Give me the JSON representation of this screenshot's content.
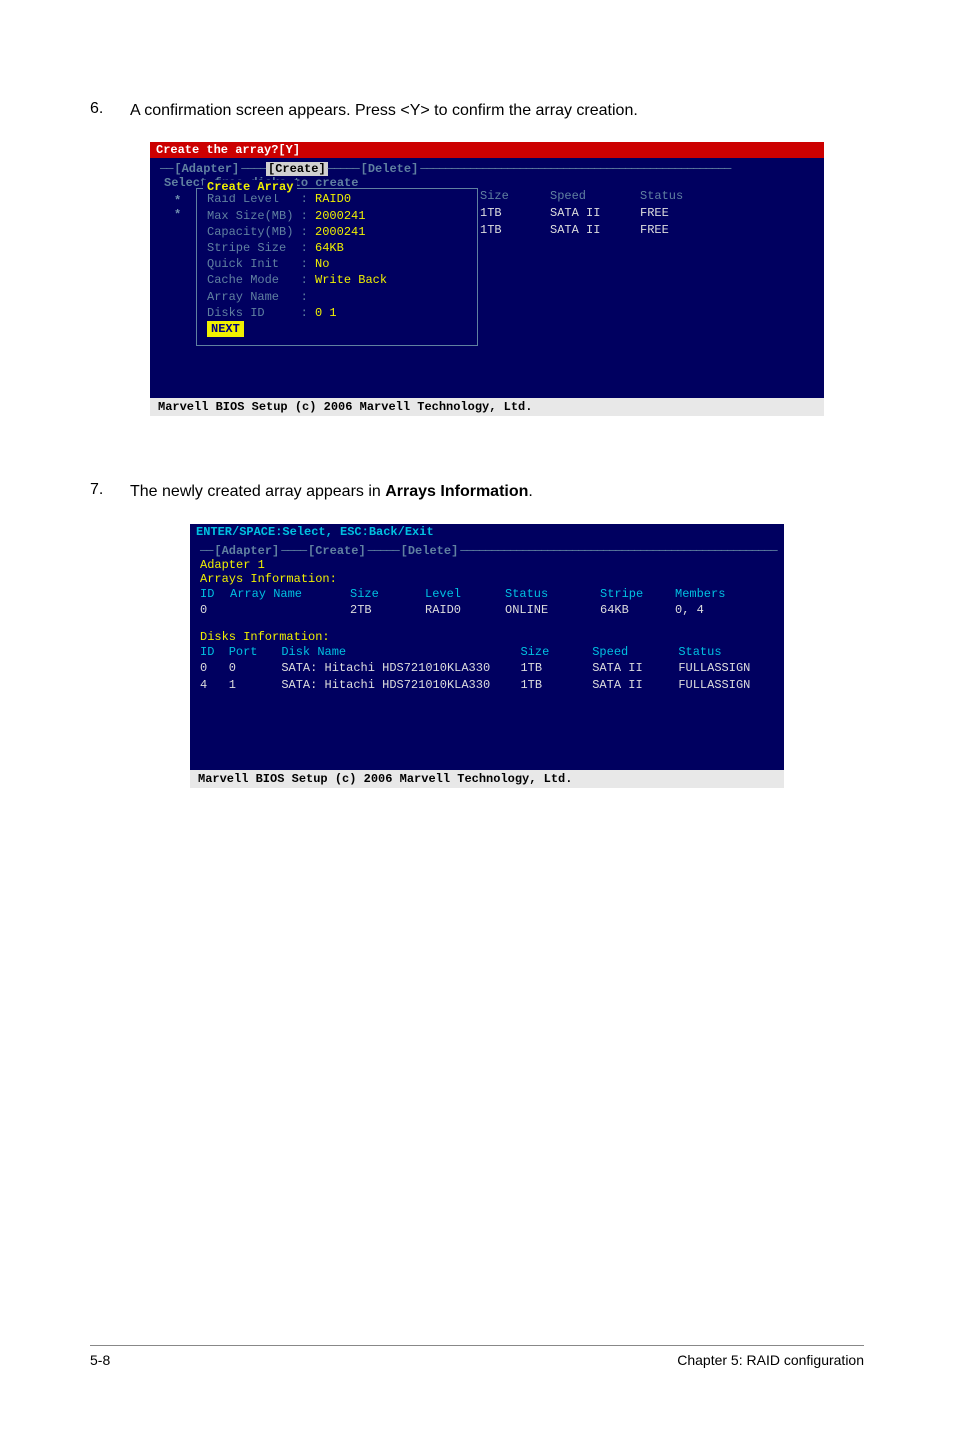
{
  "step6": {
    "num": "6.",
    "text": "A confirmation screen appears. Press <Y> to confirm the array creation."
  },
  "step7": {
    "num": "7.",
    "text_pre": "The newly created array appears in ",
    "text_bold": "Arrays Information",
    "text_post": "."
  },
  "bios1": {
    "header": "Create the array?[Y]",
    "tabs": {
      "adapter": "[Adapter]",
      "create": "[Create]",
      "delete": "[Delete]"
    },
    "sel_disks": "Select free disks to create",
    "create_array_title": "Create Array",
    "fields": {
      "raid_level": {
        "label": "Raid Level   ",
        "colon": ": ",
        "value": "RAID0"
      },
      "max_size": {
        "label": "Max Size(MB) ",
        "colon": ": ",
        "value": "2000241"
      },
      "capacity": {
        "label": "Capacity(MB) ",
        "colon": ": ",
        "value": "2000241"
      },
      "stripe_size": {
        "label": "Stripe Size  ",
        "colon": ": ",
        "value": "64KB"
      },
      "quick_init": {
        "label": "Quick Init   ",
        "colon": ": ",
        "value": "No"
      },
      "cache_mode": {
        "label": "Cache Mode   ",
        "colon": ": ",
        "value": "Write Back"
      },
      "array_name": {
        "label": "Array Name   ",
        "colon": ": ",
        "value": ""
      },
      "disks_id": {
        "label": "Disks ID     ",
        "colon": ": ",
        "value": "0 1"
      }
    },
    "next": "NEXT",
    "disk_headers": {
      "size": "Size",
      "speed": "Speed",
      "status": "Status"
    },
    "disks": [
      {
        "size": "1TB",
        "speed": "SATA II",
        "status": "FREE"
      },
      {
        "size": "1TB",
        "speed": "SATA II",
        "status": "FREE"
      }
    ],
    "footer": "Marvell BIOS Setup (c) 2006 Marvell Technology, Ltd."
  },
  "bios2": {
    "hint": "ENTER/SPACE:Select, ESC:Back/Exit",
    "tabs": {
      "adapter": "[Adapter]",
      "create": "[Create]",
      "delete": "[Delete]"
    },
    "adapter": "Adapter 1",
    "arrays_title": "Arrays Information:",
    "arrays_headers": {
      "id": "ID",
      "name": "Array Name",
      "size": "Size",
      "level": "Level",
      "status": "Status",
      "stripe": "Stripe",
      "members": "Members"
    },
    "arrays": [
      {
        "id": "0",
        "name": "",
        "size": "2TB",
        "level": "RAID0",
        "status": "ONLINE",
        "stripe": "64KB",
        "members": "0, 4"
      }
    ],
    "disks_title": "Disks Information:",
    "disks_headers": {
      "id": "ID",
      "port": "Port",
      "name": "Disk Name",
      "size": "Size",
      "speed": "Speed",
      "status": "Status"
    },
    "disks": [
      {
        "id": "0",
        "port": "0",
        "name": "SATA: Hitachi HDS721010KLA330",
        "size": "1TB",
        "speed": "SATA II",
        "status": "FULLASSIGN"
      },
      {
        "id": "4",
        "port": "1",
        "name": "SATA: Hitachi HDS721010KLA330",
        "size": "1TB",
        "speed": "SATA II",
        "status": "FULLASSIGN"
      }
    ],
    "footer": "Marvell BIOS Setup (c) 2006 Marvell Technology, Ltd."
  },
  "page_footer": {
    "left": "5-8",
    "right": "Chapter 5: RAID configuration"
  }
}
